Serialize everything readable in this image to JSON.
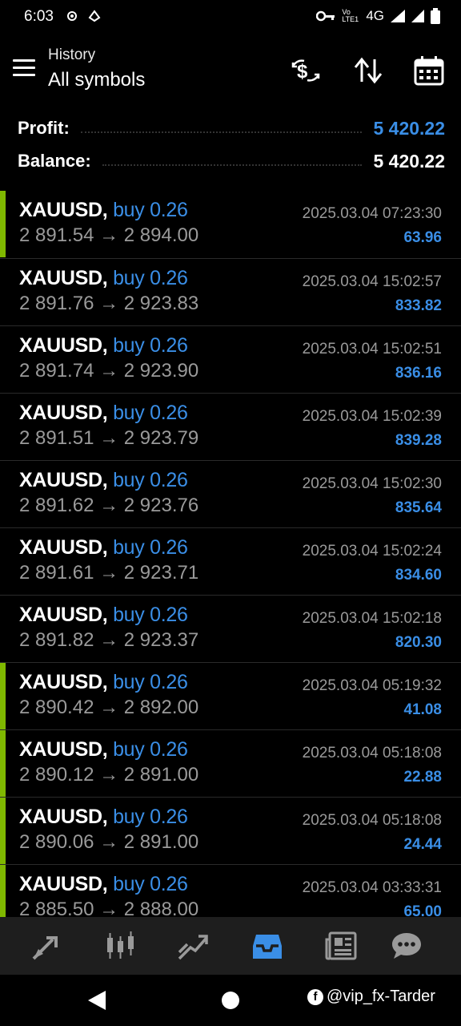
{
  "status_bar": {
    "time": "6:03",
    "network": "4G",
    "lte": "Vo LTE1"
  },
  "header": {
    "subtitle": "History",
    "title": "All symbols",
    "icons": [
      "currency-exchange-icon",
      "sort-icon",
      "calendar-icon"
    ]
  },
  "summary": {
    "profit_label": "Profit:",
    "profit_value": "5 420.22",
    "balance_label": "Balance:",
    "balance_value": "5 420.22"
  },
  "colors": {
    "accent_blue": "#3a8ee6",
    "profit_bar_green": "#7fb800",
    "muted_gray": "#9a9a9a"
  },
  "trades": [
    {
      "symbol": "XAUUSD,",
      "direction": "buy 0.26",
      "prices": "2 891.54 → 2 894.00",
      "time": "2025.03.04 07:23:30",
      "profit": "63.96",
      "bar": true
    },
    {
      "symbol": "XAUUSD,",
      "direction": "buy 0.26",
      "prices": "2 891.76 → 2 923.83",
      "time": "2025.03.04 15:02:57",
      "profit": "833.82",
      "bar": false
    },
    {
      "symbol": "XAUUSD,",
      "direction": "buy 0.26",
      "prices": "2 891.74 → 2 923.90",
      "time": "2025.03.04 15:02:51",
      "profit": "836.16",
      "bar": false
    },
    {
      "symbol": "XAUUSD,",
      "direction": "buy 0.26",
      "prices": "2 891.51 → 2 923.79",
      "time": "2025.03.04 15:02:39",
      "profit": "839.28",
      "bar": false
    },
    {
      "symbol": "XAUUSD,",
      "direction": "buy 0.26",
      "prices": "2 891.62 → 2 923.76",
      "time": "2025.03.04 15:02:30",
      "profit": "835.64",
      "bar": false
    },
    {
      "symbol": "XAUUSD,",
      "direction": "buy 0.26",
      "prices": "2 891.61 → 2 923.71",
      "time": "2025.03.04 15:02:24",
      "profit": "834.60",
      "bar": false
    },
    {
      "symbol": "XAUUSD,",
      "direction": "buy 0.26",
      "prices": "2 891.82 → 2 923.37",
      "time": "2025.03.04 15:02:18",
      "profit": "820.30",
      "bar": false
    },
    {
      "symbol": "XAUUSD,",
      "direction": "buy 0.26",
      "prices": "2 890.42 → 2 892.00",
      "time": "2025.03.04 05:19:32",
      "profit": "41.08",
      "bar": true
    },
    {
      "symbol": "XAUUSD,",
      "direction": "buy 0.26",
      "prices": "2 890.12 → 2 891.00",
      "time": "2025.03.04 05:18:08",
      "profit": "22.88",
      "bar": true
    },
    {
      "symbol": "XAUUSD,",
      "direction": "buy 0.26",
      "prices": "2 890.06 → 2 891.00",
      "time": "2025.03.04 05:18:08",
      "profit": "24.44",
      "bar": true
    },
    {
      "symbol": "XAUUSD,",
      "direction": "buy 0.26",
      "prices": "2 885.50 → 2 888.00",
      "time": "2025.03.04 03:33:31",
      "profit": "65.00",
      "bar": true
    }
  ],
  "bottom_nav": {
    "items": [
      "quotes-icon",
      "chart-icon",
      "trade-icon",
      "history-icon",
      "news-icon",
      "chat-icon"
    ],
    "active": "history-icon"
  },
  "watermark": {
    "text": "@vip_fx-Tarder"
  }
}
